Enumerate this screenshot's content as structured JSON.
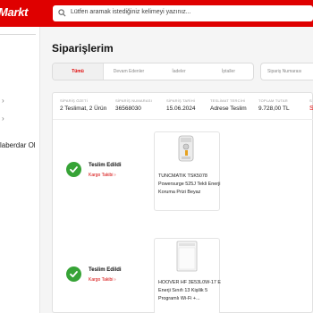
{
  "header": {
    "logo_text": "Markt",
    "search_placeholder": "Lütfen aramak istediğiniz kelimeyi yazınız..."
  },
  "sidebar": {
    "truncated_item": "laberdar Ol"
  },
  "page": {
    "title": "Siparişlerim",
    "tabs": [
      {
        "label": "Tümü",
        "active": true
      },
      {
        "label": "Devam Edenler",
        "active": false
      },
      {
        "label": "İadeler",
        "active": false
      },
      {
        "label": "İptaller",
        "active": false
      }
    ],
    "order_search_placeholder": "Sipariş Numarası"
  },
  "order": {
    "summary": [
      {
        "label": "SİPARİŞ ÖZETİ",
        "value": "2 Teslimat, 2 Ürün"
      },
      {
        "label": "SİPARİŞ NUMARASI",
        "value": "36568030"
      },
      {
        "label": "SİPARİŞ TARİHİ",
        "value": "15.06.2024"
      },
      {
        "label": "TESLİMAT TERCİHİ",
        "value": "Adrese Teslim"
      },
      {
        "label": "TOPLAM TUTAR",
        "value": "9.728,00 TL"
      },
      {
        "label": "S",
        "value": "S"
      }
    ],
    "deliveries": [
      {
        "status": "Teslim Edildi",
        "tracking": "Kargo Takibi",
        "product_name": "TUNCMATIK TSK5078 Powersurge 525J Tekli Enerji Koruma Prizi Beyaz"
      },
      {
        "status": "Teslim Edildi",
        "tracking": "Kargo Takibi",
        "product_name": "HOOVER HF 3E53L0W-17 E Enerji Sınıfı 13 Kişilik 5 Programlı Wi-Fi +..."
      }
    ]
  },
  "colors": {
    "brand_red": "#df0000",
    "success_green": "#36a336"
  },
  "icons": {
    "search": "search-icon",
    "chevron": "chevron-right-icon",
    "check": "check-icon"
  }
}
